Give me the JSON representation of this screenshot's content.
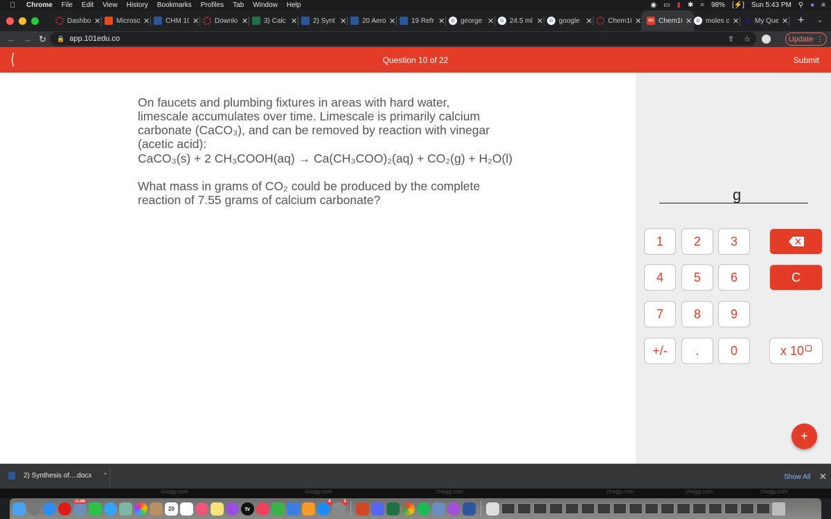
{
  "menubar": {
    "app_name": "Chrome",
    "items": [
      "File",
      "Edit",
      "View",
      "History",
      "Bookmarks",
      "Profiles",
      "Tab",
      "Window",
      "Help"
    ],
    "battery": "98%",
    "clock": "Sun 5:43 PM"
  },
  "tabs": [
    {
      "label": "Dashbo",
      "icon": "canvas-icon",
      "color": "#d32f2f"
    },
    {
      "label": "Microso",
      "icon": "office-icon",
      "color": "#e64a19"
    },
    {
      "label": "CHM 10",
      "icon": "word-icon",
      "color": "#2b579a"
    },
    {
      "label": "Downlo",
      "icon": "canvas-icon",
      "color": "#d32f2f"
    },
    {
      "label": "3) Calc",
      "icon": "excel-icon",
      "color": "#1f7244"
    },
    {
      "label": "2) Synt",
      "icon": "word-icon",
      "color": "#2b579a"
    },
    {
      "label": "20 Aero",
      "icon": "word-icon",
      "color": "#2b579a"
    },
    {
      "label": "19 Refr",
      "icon": "word-icon",
      "color": "#2b579a"
    },
    {
      "label": "george",
      "icon": "google-icon",
      "color": "#4285f4"
    },
    {
      "label": "24.5 ml",
      "icon": "google-icon",
      "color": "#4285f4"
    },
    {
      "label": "google",
      "icon": "google-icon",
      "color": "#4285f4"
    },
    {
      "label": "Chem10",
      "icon": "canvas-icon",
      "color": "#d32f2f"
    },
    {
      "label": "Chem10",
      "icon": "101edu-icon",
      "color": "#e33d27",
      "active": true
    },
    {
      "label": "moles c",
      "icon": "google-icon",
      "color": "#4285f4"
    },
    {
      "label": "My Que",
      "icon": "bing-icon",
      "color": "#1a237e"
    }
  ],
  "toolbar": {
    "url": "app.101edu.co",
    "update_label": "Update"
  },
  "header": {
    "question_counter": "Question 10 of 22",
    "submit_label": "Submit"
  },
  "question": {
    "intro": "On faucets and plumbing fixtures in areas with hard water, limescale accumulates over time. Limescale is primarily calcium carbonate (CaCO₃), and can be removed by reaction with vinegar (acetic acid):",
    "equation": "CaCO₃(s) + 2 CH₃COOH(aq) → Ca(CH₃COO)₂(aq) + CO₂(g) + H₂O(l)",
    "prompt": "What mass in grams of CO₂ could be produced by the complete reaction of 7.55 grams of calcium carbonate?"
  },
  "answer": {
    "value": "",
    "unit": "g"
  },
  "keypad": {
    "keys": [
      "1",
      "2",
      "3",
      "4",
      "5",
      "6",
      "7",
      "8",
      "9",
      "+/-",
      ".",
      "0"
    ],
    "backspace_label": "⌫",
    "clear_label": "C",
    "sci_label": "x 10"
  },
  "fab_label": "+",
  "download_bar": {
    "file_name": "2) Synthesis of....docx",
    "show_all_label": "Show All"
  },
  "dock": {
    "calendar_day": "20",
    "mail_badge": "13,086",
    "appstore_badge": "8",
    "prefs_badge": "3",
    "background_text": "chegg.com"
  }
}
